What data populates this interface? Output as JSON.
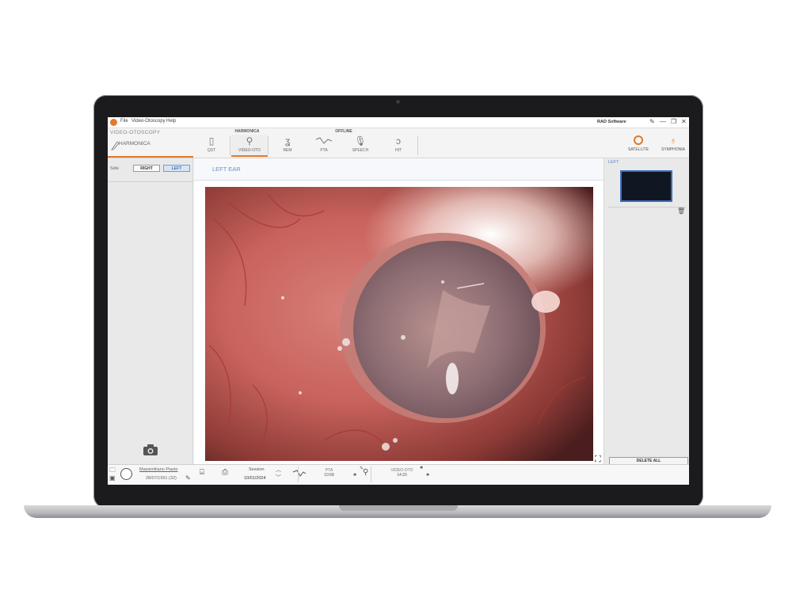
{
  "menu": [
    "File",
    "Video-Otoscopy",
    "Help"
  ],
  "window_title": "RAD Software",
  "window_controls": {
    "minimize": "—",
    "restore": "❐",
    "close": "✕"
  },
  "module": {
    "title": "VIDEO-OTOSCOPY",
    "subtitle": "HARMONICA"
  },
  "toolbar": {
    "group_harmonica": "HARMONICA",
    "group_offline": "OFFLINE",
    "tools": [
      {
        "label": "QST",
        "icon": "qst-icon"
      },
      {
        "label": "VIDEO-OTO",
        "icon": "otoscope-icon"
      },
      {
        "label": "REM",
        "icon": "ear-icon"
      },
      {
        "label": "PTA",
        "icon": "audiogram-icon"
      },
      {
        "label": "SPEECH",
        "icon": "microphone-icon"
      },
      {
        "label": "HIT",
        "icon": "hearing-aid-icon"
      }
    ],
    "satellite": "SATELLITE",
    "symphonia": "SYMPHONIA"
  },
  "side": {
    "label": "Side",
    "right": "RIGHT",
    "left": "LEFT",
    "selected": "LEFT"
  },
  "main": {
    "title": "LEFT EAR"
  },
  "right_panel": {
    "label": "LEFT",
    "delete_all": "DELETE ALL"
  },
  "bottom": {
    "patient_name": "Massimiliano Piasto",
    "patient_dob": "28/07/1991 (32)",
    "session_label": "Session",
    "session_date": "10/01/2024",
    "tabs": [
      {
        "title": "PTA",
        "time": "10:58"
      },
      {
        "title": "VIDEO-OTO",
        "time": "14:20"
      }
    ]
  },
  "colors": {
    "accent": "#e07a2a",
    "selection_blue": "#6f8fc4"
  }
}
